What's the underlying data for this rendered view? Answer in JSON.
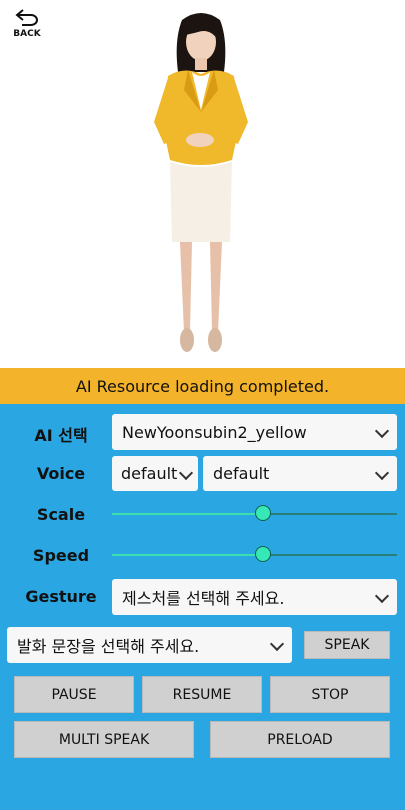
{
  "header": {
    "back_label": "BACK"
  },
  "status": {
    "message": "AI Resource loading completed."
  },
  "controls": {
    "ai_select": {
      "label": "AI 선택",
      "value": "NewYoonsubin2_yellow"
    },
    "voice": {
      "label": "Voice",
      "value_left": "default",
      "value_right": "default"
    },
    "scale": {
      "label": "Scale",
      "value": 0.53
    },
    "speed": {
      "label": "Speed",
      "value": 0.53
    },
    "gesture": {
      "label": "Gesture",
      "value": "제스처를 선택해 주세요."
    },
    "speech": {
      "value": "발화 문장을 선택해 주세요.",
      "speak_label": "SPEAK"
    }
  },
  "buttons": {
    "pause": "PAUSE",
    "resume": "RESUME",
    "stop": "STOP",
    "multi_speak": "MULTI SPEAK",
    "preload": "PRELOAD"
  },
  "colors": {
    "status_bg": "#f3b32a",
    "panel_bg": "#2aa7e3",
    "slider_thumb": "#35e8b5"
  },
  "icons": {
    "back": "back-arrow-icon"
  }
}
